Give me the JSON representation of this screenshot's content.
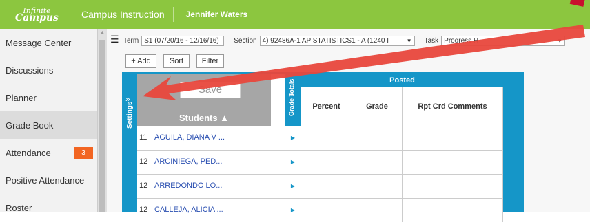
{
  "header": {
    "logo_line1": "Infinite",
    "logo_line2": "Campus",
    "app_title": "Campus Instruction",
    "user_name": "Jennifer Waters"
  },
  "sidebar": {
    "items": [
      {
        "label": "Message Center"
      },
      {
        "label": "Discussions"
      },
      {
        "label": "Planner"
      },
      {
        "label": "Grade Book",
        "active": true
      },
      {
        "label": "Attendance",
        "badge": "3"
      },
      {
        "label": "Positive Attendance"
      },
      {
        "label": "Roster"
      }
    ]
  },
  "filters": {
    "term_label": "Term",
    "term_value": "S1 (07/20/16 - 12/16/16)",
    "section_label": "Section",
    "section_value": "4) 92486A-1 AP STATISTICS1 - A (1240 I",
    "task_label": "Task",
    "task_value": "Progress R"
  },
  "toolbar": {
    "add": "+ Add",
    "sort": "Sort",
    "filter": "Filter"
  },
  "gradebook": {
    "settings_label": "Settings",
    "save_label": "Save",
    "students_label": "Students ▲",
    "grade_totals_label": "Grade Totals",
    "posted_label": "Posted",
    "columns": [
      "Percent",
      "Grade",
      "Rpt Crd Comments"
    ],
    "rows": [
      {
        "grade": "11",
        "name": "AGUILA, DIANA V ..."
      },
      {
        "grade": "12",
        "name": "ARCINIEGA, PED..."
      },
      {
        "grade": "12",
        "name": "ARREDONDO LO..."
      },
      {
        "grade": "12",
        "name": "CALLEJA, ALICIA ..."
      }
    ]
  },
  "colors": {
    "header_green": "#8cc63f",
    "accent_blue": "#1596c8",
    "badge_orange": "#f26522",
    "annotation_red": "#e8473c"
  }
}
